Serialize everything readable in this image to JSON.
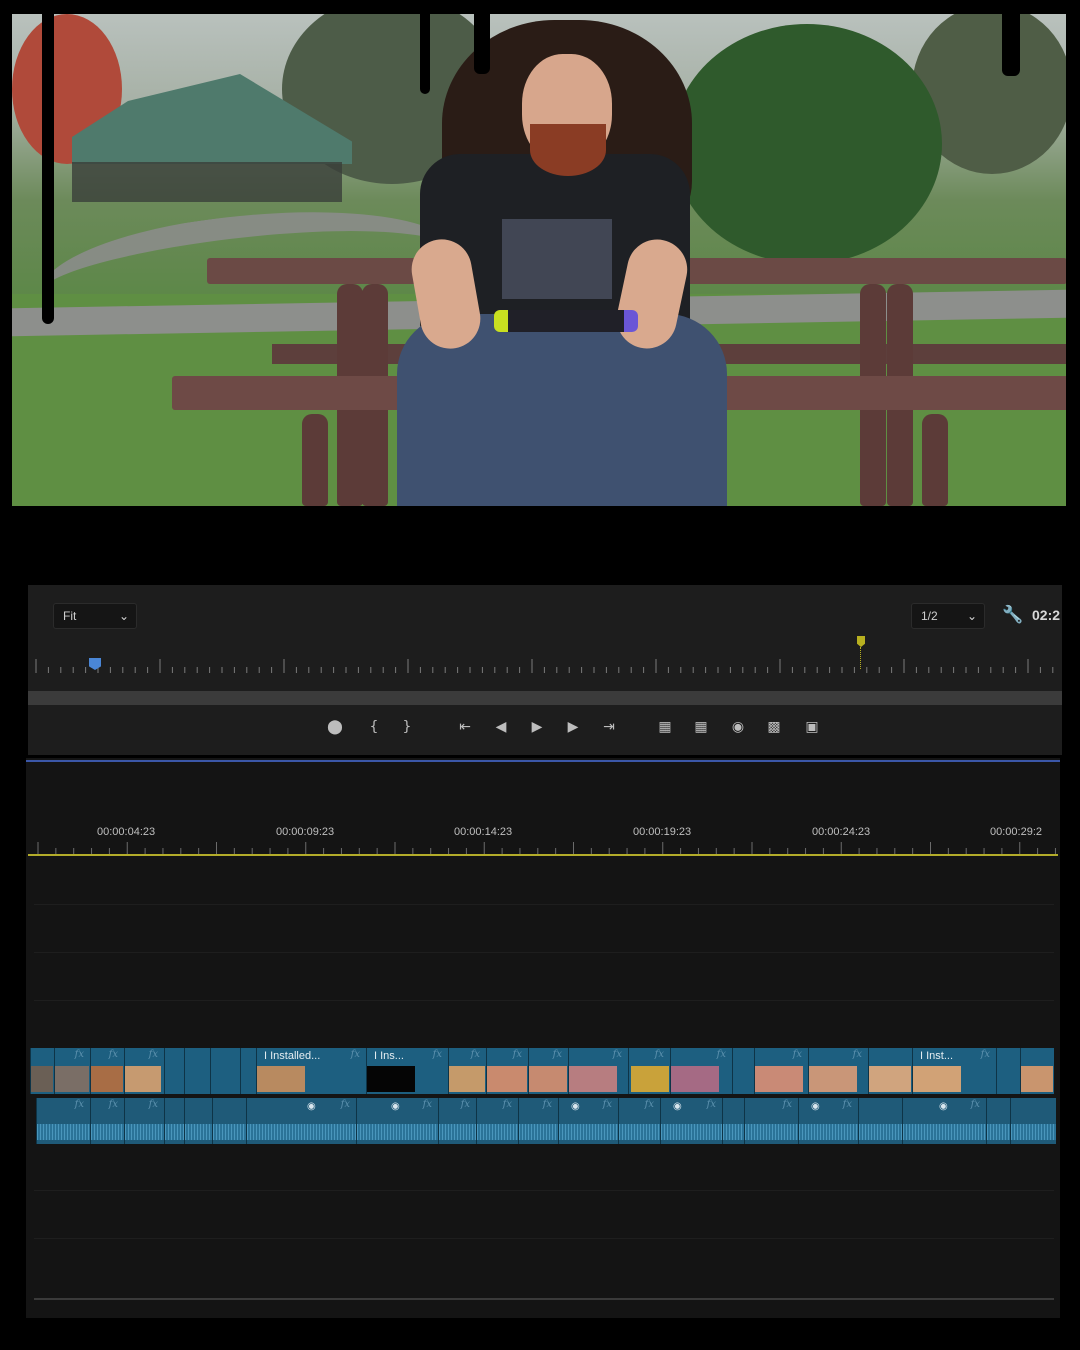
{
  "monitor": {
    "zoom_select": "Fit",
    "resolution_select": "1/2",
    "settings_icon": "wrench-icon",
    "timecode": "02:2"
  },
  "transport": {
    "buttons": [
      "add-marker",
      "mark-in",
      "mark-out",
      "go-to-in",
      "step-back",
      "play",
      "step-forward",
      "go-to-out",
      "lift",
      "extract",
      "export-frame",
      "comparison-view",
      "button-editor"
    ]
  },
  "timeline": {
    "ruler_labels": [
      "00:00:04:23",
      "00:00:09:23",
      "00:00:14:23",
      "00:00:19:23",
      "00:00:24:23",
      "00:00:29:2"
    ],
    "video_clip_names": [
      "I Installed...",
      "I Ins...",
      "I Inst..."
    ],
    "fx_label": "fx"
  },
  "colors": {
    "clip_video": "#1d5f80",
    "clip_audio": "#1f5a78",
    "work_area_bar": "#b3ac2a",
    "playhead": "#4a86d6",
    "panel_bg": "#1d1d1d"
  }
}
